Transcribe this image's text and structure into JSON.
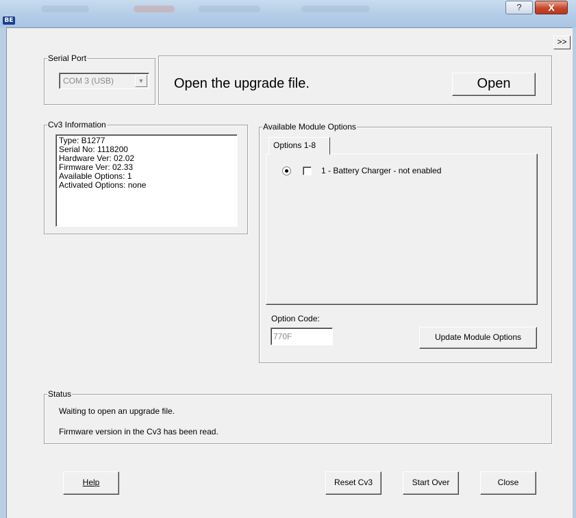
{
  "window": {
    "icon_text": "BE",
    "help_button": "?",
    "close_button": "X"
  },
  "expand_button": ">>",
  "serial_port": {
    "label": "Serial Port",
    "selected": "COM 3 (USB)"
  },
  "upgrade": {
    "prompt": "Open the upgrade file.",
    "open_button": "Open"
  },
  "cv3_info": {
    "label": "Cv3 Information",
    "lines": [
      "Type: B1277",
      "Serial No: 1118200",
      "Hardware Ver: 02.02",
      "Firmware Ver: 02.33",
      "Available Options: 1",
      "Activated Options: none"
    ]
  },
  "module_options": {
    "label": "Available Module Options",
    "tab": "Options 1-8",
    "options": [
      {
        "label": "1 - Battery Charger - not enabled",
        "selected": true,
        "checked": false
      }
    ],
    "option_code_label": "Option Code:",
    "option_code_value": "770F",
    "update_button": "Update Module Options"
  },
  "status": {
    "label": "Status",
    "lines": [
      "Waiting to open an upgrade file.",
      "Firmware version in the Cv3 has been read."
    ]
  },
  "footer": {
    "help_button": "Help",
    "reset_button": "Reset Cv3",
    "start_over_button": "Start Over",
    "close_button": "Close"
  }
}
